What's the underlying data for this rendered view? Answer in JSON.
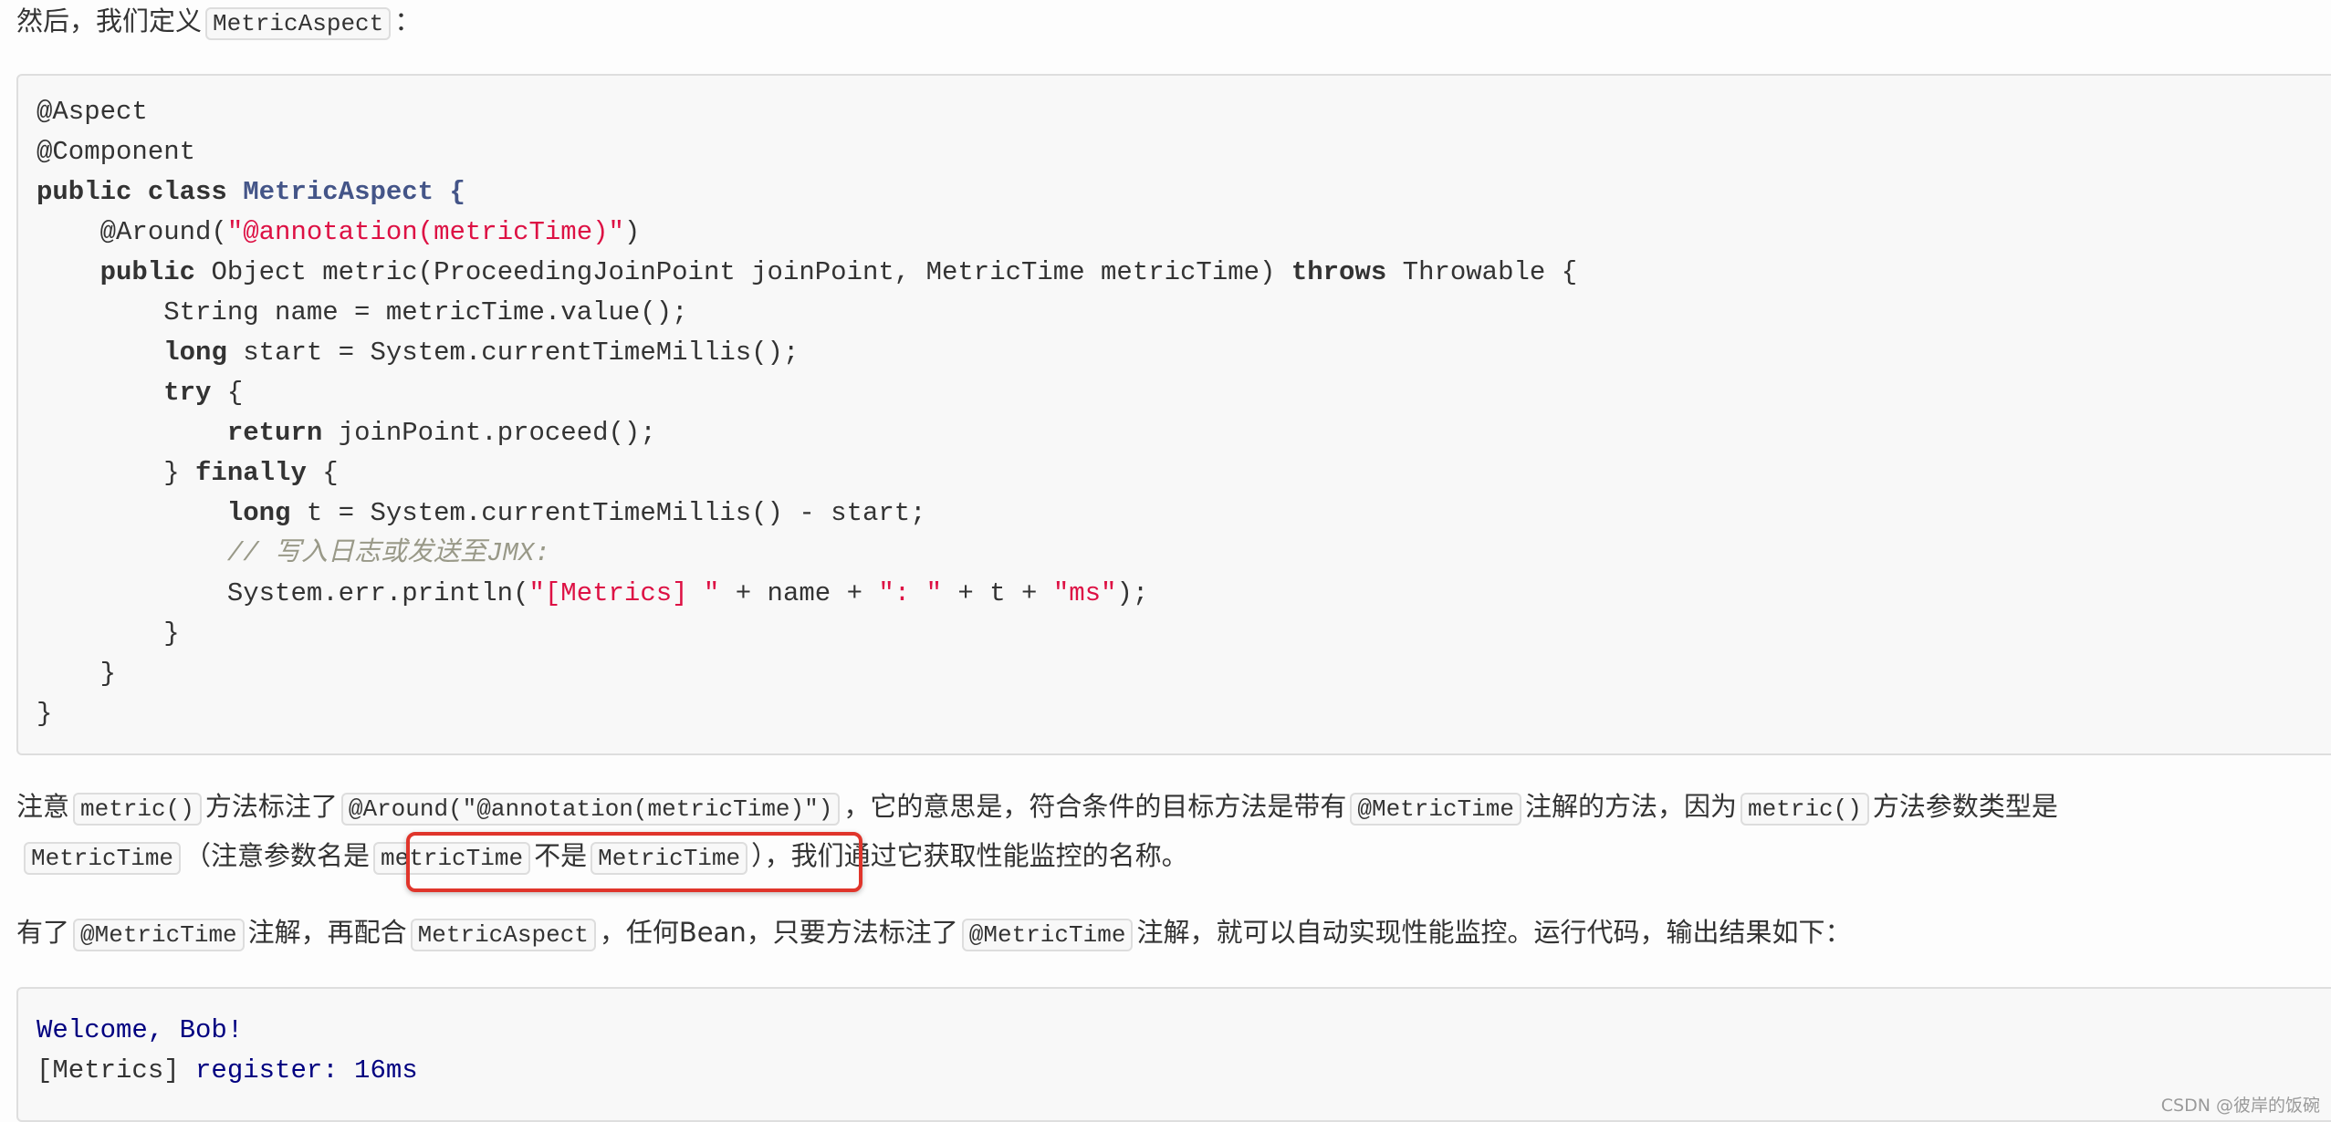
{
  "intro": {
    "text_before": "然后，我们定义",
    "code": "MetricAspect",
    "text_after": "："
  },
  "code_block": {
    "language": "java",
    "lines": [
      [
        {
          "t": "plain",
          "v": "@Aspect"
        }
      ],
      [
        {
          "t": "plain",
          "v": "@Component"
        }
      ],
      [
        {
          "t": "kw",
          "v": "public class "
        },
        {
          "t": "cls",
          "v": "MetricAspect {"
        }
      ],
      [
        {
          "t": "plain",
          "v": "    @Around("
        },
        {
          "t": "str",
          "v": "\"@annotation(metricTime)\""
        },
        {
          "t": "plain",
          "v": ")"
        }
      ],
      [
        {
          "t": "plain",
          "v": "    "
        },
        {
          "t": "kw",
          "v": "public"
        },
        {
          "t": "plain",
          "v": " Object metric(ProceedingJoinPoint joinPoint, MetricTime metricTime) "
        },
        {
          "t": "kw",
          "v": "throws"
        },
        {
          "t": "plain",
          "v": " Throwable {"
        }
      ],
      [
        {
          "t": "plain",
          "v": "        String name = metricTime.value();"
        }
      ],
      [
        {
          "t": "plain",
          "v": "        "
        },
        {
          "t": "kw",
          "v": "long"
        },
        {
          "t": "plain",
          "v": " start = System.currentTimeMillis();"
        }
      ],
      [
        {
          "t": "plain",
          "v": "        "
        },
        {
          "t": "kw",
          "v": "try"
        },
        {
          "t": "plain",
          "v": " {"
        }
      ],
      [
        {
          "t": "plain",
          "v": "            "
        },
        {
          "t": "kw",
          "v": "return"
        },
        {
          "t": "plain",
          "v": " joinPoint.proceed();"
        }
      ],
      [
        {
          "t": "plain",
          "v": "        } "
        },
        {
          "t": "kw",
          "v": "finally"
        },
        {
          "t": "plain",
          "v": " {"
        }
      ],
      [
        {
          "t": "plain",
          "v": "            "
        },
        {
          "t": "kw",
          "v": "long"
        },
        {
          "t": "plain",
          "v": " t = System.currentTimeMillis() - start;"
        }
      ],
      [
        {
          "t": "plain",
          "v": "            "
        },
        {
          "t": "cm",
          "v": "// 写入日志或发送至JMX:"
        }
      ],
      [
        {
          "t": "plain",
          "v": "            System.err.println("
        },
        {
          "t": "str",
          "v": "\"[Metrics] \""
        },
        {
          "t": "plain",
          "v": " + name + "
        },
        {
          "t": "str",
          "v": "\": \""
        },
        {
          "t": "plain",
          "v": " + t + "
        },
        {
          "t": "str",
          "v": "\"ms\""
        },
        {
          "t": "plain",
          "v": ");"
        }
      ],
      [
        {
          "t": "plain",
          "v": "        }"
        }
      ],
      [
        {
          "t": "plain",
          "v": "    }"
        }
      ],
      [
        {
          "t": "plain",
          "v": "}"
        }
      ]
    ]
  },
  "explanation": {
    "line1": {
      "t1": "注意",
      "c1": "metric()",
      "t2": "方法标注了",
      "c2": "@Around(\"@annotation(metricTime)\")",
      "t3": "，它的意思是，符合条件的目标方法是带有",
      "c3": "@MetricTime",
      "t4": "注解的方法，因为",
      "c4": "metric()",
      "t5": "方法参数类型是"
    },
    "line2": {
      "c1": "MetricTime",
      "t1": "（注意参数名是",
      "c2": "metricTime",
      "t2": "不是",
      "c3": "MetricTime",
      "t3": "），我们通过它获取性能监控的名称。"
    }
  },
  "usage": {
    "t1": "有了",
    "c1": "@MetricTime",
    "t2": "注解，再配合",
    "c2": "MetricAspect",
    "t3": "，任何Bean，只要方法标注了",
    "c3": "@MetricTime",
    "t4": "注解，就可以自动实现性能监控。运行代码，输出结果如下："
  },
  "output_block": {
    "lines": [
      [
        {
          "t": "nv",
          "v": "Welcome, Bob!"
        }
      ],
      [
        {
          "t": "plain",
          "v": "[Metrics] "
        },
        {
          "t": "nv",
          "v": "register: 16ms"
        }
      ]
    ]
  },
  "highlight_color": "#e0352b",
  "watermark": "CSDN @彼岸的饭碗"
}
